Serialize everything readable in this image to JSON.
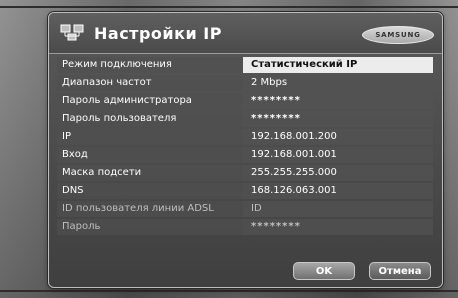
{
  "dialog": {
    "title": "Настройки IP",
    "brand": "SAMSUNG",
    "icon": "network-icon"
  },
  "settings": [
    {
      "label": "Режим подключения",
      "value": "Статистический IP",
      "selected": true,
      "enabled": true
    },
    {
      "label": "Диапазон частот",
      "value": "2 Mbps",
      "selected": false,
      "enabled": true
    },
    {
      "label": "Пароль администратора",
      "value": "********",
      "selected": false,
      "enabled": true
    },
    {
      "label": "Пароль пользователя",
      "value": "********",
      "selected": false,
      "enabled": true
    },
    {
      "label": "IP",
      "value": "192.168.001.200",
      "selected": false,
      "enabled": true
    },
    {
      "label": "Вход",
      "value": "192.168.001.001",
      "selected": false,
      "enabled": true
    },
    {
      "label": "Маска подсети",
      "value": "255.255.255.000",
      "selected": false,
      "enabled": true
    },
    {
      "label": "DNS",
      "value": "168.126.063.001",
      "selected": false,
      "enabled": true
    },
    {
      "label": "ID пользователя линии ADSL",
      "value": "ID",
      "selected": false,
      "enabled": false
    },
    {
      "label": "Пароль",
      "value": "********",
      "selected": false,
      "enabled": false
    }
  ],
  "buttons": {
    "ok": "OK",
    "cancel": "Отмена"
  },
  "colors": {
    "selected_background": "#ececec",
    "panel_background": "#4b4b4b",
    "text": "#ffffff"
  }
}
